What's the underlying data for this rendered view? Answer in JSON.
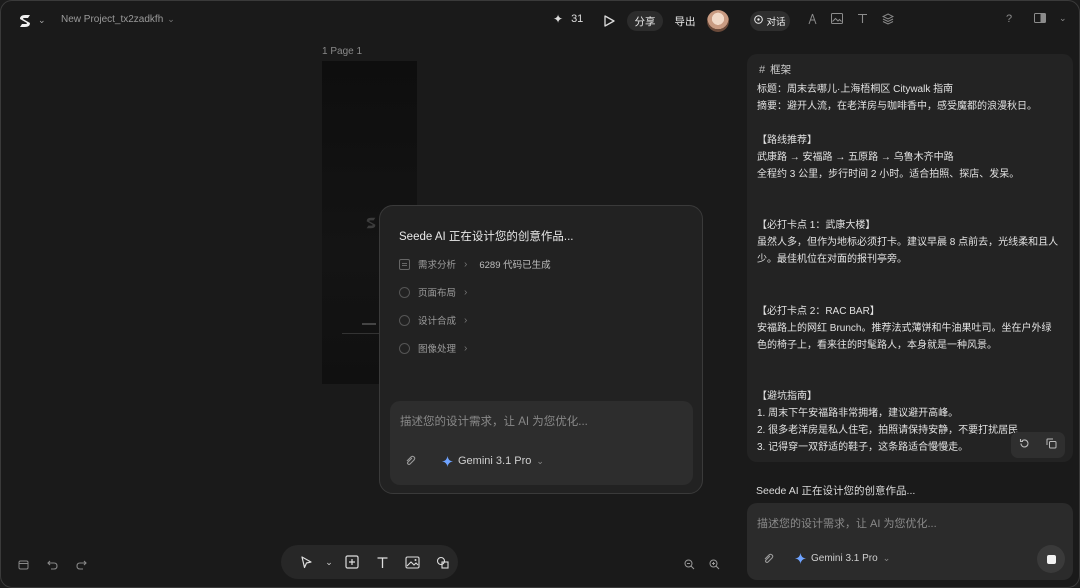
{
  "header": {
    "project_name": "New Project_tx2zadkfh",
    "credits": "31",
    "share_label": "分享",
    "export_label": "导出"
  },
  "canvas": {
    "page_label": "1 Page 1"
  },
  "ai_card": {
    "title": "Seede AI 正在设计您的创意作品...",
    "steps": [
      {
        "label": "需求分析",
        "detail": "6289 代码已生成"
      },
      {
        "label": "页面布局"
      },
      {
        "label": "设计合成"
      },
      {
        "label": "图像处理"
      }
    ],
    "input_placeholder": "描述您的设计需求，让 AI 为您优化...",
    "model": "Gemini 3.1 Pro"
  },
  "right_panel": {
    "chat_tab_label": "对话",
    "frame_label": "框架",
    "lines": [
      "标题：周末去哪儿·上海梧桐区 Citywalk 指南",
      "摘要：避开人流，在老洋房与咖啡香中，感受魔都的浪漫秋日。",
      "【路线推荐】",
      "武康路 → 安福路 → 五原路 → 乌鲁木齐中路",
      "全程约 3 公里，步行时间 2 小时。适合拍照、探店、发呆。",
      "【必打卡点 1：武康大楼】",
      "虽然人多，但作为地标必须打卡。建议早晨 8 点前去，光线柔和且人",
      "少。最佳机位在对面的报刊亭旁。",
      "【必打卡点 2：RAC BAR】",
      "安福路上的网红 Brunch。推荐法式薄饼和牛油果吐司。坐在户外绿",
      "色的椅子上，看来往的时髦路人，本身就是一种风景。",
      "【避坑指南】",
      "1. 周末下午安福路非常拥堵，建议避开高峰。",
      "2. 很多老洋房是私人住宅，拍照请保持安静，不要打扰居民",
      "3. 记得穿一双舒适的鞋子，这条路适合慢慢走。"
    ],
    "status": "Seede AI 正在设计您的创意作品...",
    "input_placeholder": "描述您的设计需求，让 AI 为您优化...",
    "model": "Gemini 3.1 Pro"
  },
  "colors": {
    "background": "#1a1a1a",
    "panel": "#232323",
    "gemini_blue": "#6fa3ff"
  }
}
